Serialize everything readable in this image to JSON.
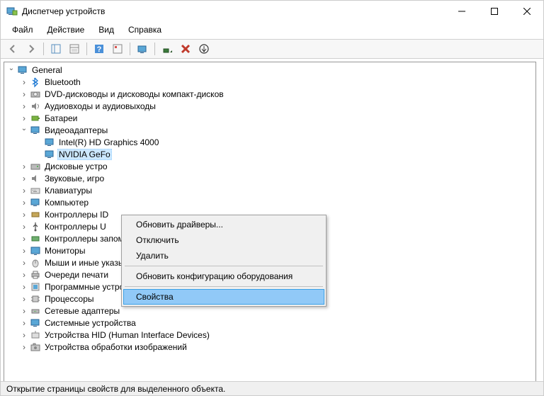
{
  "window": {
    "title": "Диспетчер устройств"
  },
  "menu": {
    "file": "Файл",
    "action": "Действие",
    "view": "Вид",
    "help": "Справка"
  },
  "tree": {
    "root": "General",
    "bluetooth": "Bluetooth",
    "dvd": "DVD-дисководы и дисководы компакт-дисков",
    "audio": "Аудиовходы и аудиовыходы",
    "batteries": "Батареи",
    "display": "Видеоадаптеры",
    "display_intel": "Intel(R) HD Graphics 4000",
    "display_nvidia": "NVIDIA GeFo",
    "disk": "Дисковые устро",
    "sound": "Звуковые, игро",
    "keyboard": "Клавиатуры",
    "computer": "Компьютер",
    "ide": "Контроллеры ID",
    "usb": "Контроллеры U",
    "storage": "Контроллеры запоминающих устройств",
    "monitors": "Мониторы",
    "mice": "Мыши и иные указывающие устройства",
    "printq": "Очереди печати",
    "software": "Программные устройства",
    "cpu": "Процессоры",
    "network": "Сетевые адаптеры",
    "system": "Системные устройства",
    "hid": "Устройства HID (Human Interface Devices)",
    "imaging": "Устройства обработки изображений"
  },
  "context_menu": {
    "update": "Обновить драйверы...",
    "disable": "Отключить",
    "uninstall": "Удалить",
    "scan": "Обновить конфигурацию оборудования",
    "properties": "Свойства"
  },
  "status": "Открытие страницы свойств для выделенного объекта."
}
